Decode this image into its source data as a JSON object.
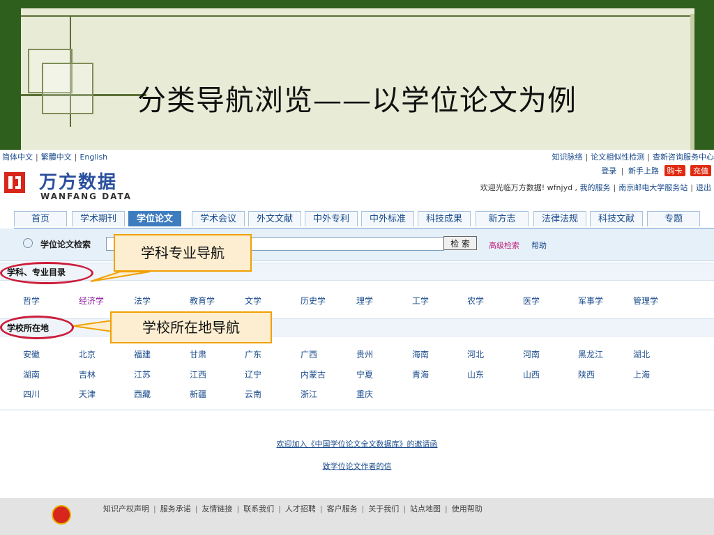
{
  "slide": {
    "title": "分类导航浏览——以学位论文为例"
  },
  "site": {
    "languages": [
      "简体中文",
      "繁體中文",
      "English"
    ],
    "top_links": [
      "知识脉络",
      "论文相似性检测",
      "查新咨询服务中心"
    ],
    "login_links": [
      "登录",
      "新手上路"
    ],
    "buy_button": "购卡",
    "recharge_button": "充值",
    "welcome_text": "欢迎光临万方数据! wfnjyd ,",
    "welcome_links": [
      "我的服务",
      "南京邮电大学服务站",
      "退出"
    ],
    "logo": {
      "cn": "万方数据",
      "en": "WANFANG DATA"
    },
    "nav_tabs": [
      "首页",
      "学术期刊",
      "学位论文",
      "学术会议",
      "外文文献",
      "中外专利",
      "中外标准",
      "科技成果",
      "新方志",
      "法律法规",
      "科技文献",
      "专题"
    ],
    "active_tab": "学位论文",
    "search": {
      "label": "学位论文检索",
      "input_value": "",
      "button": "检 索",
      "advanced": "高级检索",
      "help": "帮助"
    },
    "subject_section": {
      "title": "学科、专业目录",
      "items": [
        "哲学",
        "经济学",
        "法学",
        "教育学",
        "文学",
        "历史学",
        "理学",
        "工学",
        "农学",
        "医学",
        "军事学",
        "管理学"
      ]
    },
    "location_section": {
      "title": "学校所在地",
      "rows": [
        [
          "安徽",
          "北京",
          "福建",
          "甘肃",
          "广东",
          "广西",
          "贵州",
          "海南",
          "河北",
          "河南",
          "黑龙江",
          "湖北"
        ],
        [
          "湖南",
          "吉林",
          "江苏",
          "江西",
          "辽宁",
          "内蒙古",
          "宁夏",
          "青海",
          "山东",
          "山西",
          "陕西",
          "上海"
        ],
        [
          "四川",
          "天津",
          "西藏",
          "新疆",
          "云南",
          "浙江",
          "重庆"
        ]
      ]
    },
    "center_links": [
      "欢迎加入《中国学位论文全文数据库》的邀请函",
      "致学位论文作者的信"
    ],
    "footer_links": [
      "知识产权声明",
      "服务承诺",
      "友情链接",
      "联系我们",
      "人才招聘",
      "客户服务",
      "关于我们",
      "站点地图",
      "使用帮助"
    ]
  },
  "callouts": {
    "subject_nav": "学科专业导航",
    "location_nav": "学校所在地导航"
  },
  "colors": {
    "slide_green": "#2f5f1c",
    "link_blue": "#1a4b8c",
    "visited_purple": "#8a1c9a",
    "callout_border": "#f0a000",
    "callout_fill": "#fdeed1",
    "highlight_red": "#cc1d3a",
    "active_tab": "#3e7cc0"
  }
}
